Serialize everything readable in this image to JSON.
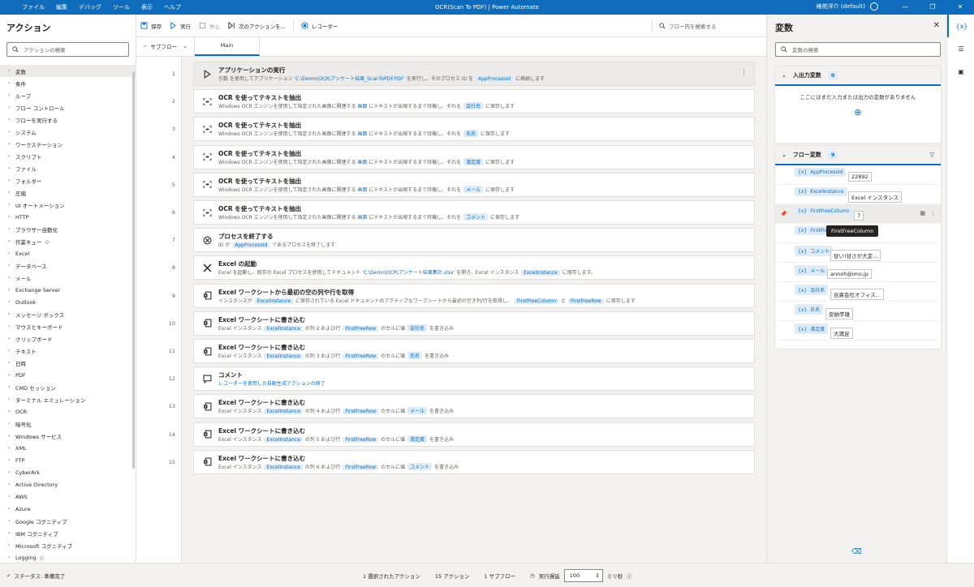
{
  "menu": [
    "ファイル",
    "編集",
    "デバッグ",
    "ツール",
    "表示",
    "ヘルプ"
  ],
  "window_title": "OCR(Scan To PDF) | Power Automate",
  "user": "椿苑洋介 (default)",
  "actions_panel": {
    "title": "アクション",
    "search_placeholder": "アクションの検索",
    "categories": [
      "変数",
      "条件",
      "ループ",
      "フロー コントロール",
      "フローを実行する",
      "システム",
      "ワークステーション",
      "スクリプト",
      "ファイル",
      "フォルダー",
      "圧縮",
      "UI オートメーション",
      "HTTP",
      "ブラウザー自動化",
      "作業キュー",
      "Excel",
      "データベース",
      "メール",
      "Exchange Server",
      "Outlook",
      "メッセージ ボックス",
      "マウスとキーボード",
      "クリップボード",
      "テキスト",
      "日時",
      "PDF",
      "CMD セッション",
      "ターミナル エミュレーション",
      "OCR",
      "暗号化",
      "Windows サービス",
      "XML",
      "FTP",
      "CyberArk",
      "Active Directory",
      "AWS",
      "Azure",
      "Google コグニティブ",
      "IBM コグニティブ",
      "Microsoft コグニティブ",
      "Logging"
    ]
  },
  "toolbar": {
    "save": "保存",
    "run": "実行",
    "stop": "停止",
    "next": "次のアクションを...",
    "recorder": "レコーダー",
    "search": "フロー内を検索する"
  },
  "tabs": {
    "subflow": "サブフロー",
    "main": "Main"
  },
  "steps": [
    {
      "n": "1",
      "icon": "play",
      "title": "アプリケーションの実行",
      "desc": [
        [
          "t",
          "引数 を使用してアプリケーション "
        ],
        [
          "l",
          "'C:\\Demo\\OCR\\アンケート結果_ScanToPDF.PDF'"
        ],
        [
          "t",
          " を実行し、そのプロセス ID を "
        ],
        [
          "v",
          "AppProcessId"
        ],
        [
          "t",
          " に格納します"
        ]
      ]
    },
    {
      "n": "2",
      "icon": "ocr",
      "title": "OCR を使ってテキストを抽出",
      "desc": [
        [
          "t",
          "Windows OCR エンジンを使用して指定された画像に関連する "
        ],
        [
          "l",
          "画面"
        ],
        [
          "t",
          " にテキストが出現するまで待機し、それを "
        ],
        [
          "v",
          "会社名"
        ],
        [
          "t",
          " に保存します"
        ]
      ]
    },
    {
      "n": "3",
      "icon": "ocr",
      "title": "OCR を使ってテキストを抽出",
      "desc": [
        [
          "t",
          "Windows OCR エンジンを使用して指定された画像に関連する "
        ],
        [
          "l",
          "画面"
        ],
        [
          "t",
          " にテキストが出現するまで待機し、それを "
        ],
        [
          "v",
          "氏名"
        ],
        [
          "t",
          " に保存します"
        ]
      ]
    },
    {
      "n": "4",
      "icon": "ocr",
      "title": "OCR を使ってテキストを抽出",
      "desc": [
        [
          "t",
          "Windows OCR エンジンを使用して指定された画像に関連する "
        ],
        [
          "l",
          "画面"
        ],
        [
          "t",
          " にテキストが出現するまで待機し、それを "
        ],
        [
          "v",
          "満足度"
        ],
        [
          "t",
          " に保存します"
        ]
      ]
    },
    {
      "n": "5",
      "icon": "ocr",
      "title": "OCR を使ってテキストを抽出",
      "desc": [
        [
          "t",
          "Windows OCR エンジンを使用して指定された画像に関連する "
        ],
        [
          "l",
          "画面"
        ],
        [
          "t",
          " にテキストが出現するまで待機し、それを "
        ],
        [
          "v",
          "メール"
        ],
        [
          "t",
          " に保存します"
        ]
      ]
    },
    {
      "n": "6",
      "icon": "ocr",
      "title": "OCR を使ってテキストを抽出",
      "desc": [
        [
          "t",
          "Windows OCR エンジンを使用して指定された画像に関連する "
        ],
        [
          "l",
          "画面"
        ],
        [
          "t",
          " にテキストが出現するまで待機し、それを "
        ],
        [
          "v",
          "コメント"
        ],
        [
          "t",
          " に保存します"
        ]
      ]
    },
    {
      "n": "7",
      "icon": "close",
      "title": "プロセスを終了する",
      "desc": [
        [
          "t",
          "ID が "
        ],
        [
          "v",
          "AppProcessId"
        ],
        [
          "t",
          " であるプロセスを終了します"
        ]
      ]
    },
    {
      "n": "8",
      "icon": "excel",
      "title": "Excel の起動",
      "desc": [
        [
          "t",
          "Excel を起動し、既存の Excel プロセスを使用してドキュメント "
        ],
        [
          "l",
          "'C:\\Demo\\OCR\\アンケート結果集計.xlsx'"
        ],
        [
          "t",
          " を開き、Excel インスタンス "
        ],
        [
          "v",
          "ExcelInstance"
        ],
        [
          "t",
          " に保存します。"
        ]
      ]
    },
    {
      "n": "9",
      "icon": "sheet",
      "title": "Excel ワークシートから最初の空の列や行を取得",
      "desc": [
        [
          "t",
          "インスタンスが "
        ],
        [
          "v",
          "ExcelInstance"
        ],
        [
          "t",
          " に保存されている Excel ドキュメントのアクティブなワークシートから最初の空き列/行を取得し、 "
        ],
        [
          "v",
          "FirstFreeColumn"
        ],
        [
          "t",
          " と "
        ],
        [
          "v",
          "FirstFreeRow"
        ],
        [
          "t",
          " に保存します"
        ]
      ]
    },
    {
      "n": "10",
      "icon": "sheet",
      "title": "Excel ワークシートに書き込む",
      "desc": [
        [
          "t",
          "Excel インスタンス "
        ],
        [
          "v",
          "ExcelInstance"
        ],
        [
          "t",
          " の列 2 および行 "
        ],
        [
          "v",
          "FirstFreeRow"
        ],
        [
          "t",
          " のセルに値 "
        ],
        [
          "v",
          "会社名"
        ],
        [
          "t",
          " を書き込み"
        ]
      ]
    },
    {
      "n": "11",
      "icon": "sheet",
      "title": "Excel ワークシートに書き込む",
      "desc": [
        [
          "t",
          "Excel インスタンス "
        ],
        [
          "v",
          "ExcelInstance"
        ],
        [
          "t",
          " の列 3 および行 "
        ],
        [
          "v",
          "FirstFreeRow"
        ],
        [
          "t",
          " のセルに値 "
        ],
        [
          "v",
          "氏名"
        ],
        [
          "t",
          " を書き込み"
        ]
      ]
    },
    {
      "n": "12",
      "icon": "comment",
      "title": "コメント",
      "desc": [
        [
          "c",
          "レコーダーを使用した自動生成アクションの終了"
        ]
      ]
    },
    {
      "n": "13",
      "icon": "sheet",
      "title": "Excel ワークシートに書き込む",
      "desc": [
        [
          "t",
          "Excel インスタンス "
        ],
        [
          "v",
          "ExcelInstance"
        ],
        [
          "t",
          " の列 4 および行 "
        ],
        [
          "v",
          "FirstFreeRow"
        ],
        [
          "t",
          " のセルに値 "
        ],
        [
          "v",
          "メール"
        ],
        [
          "t",
          " を書き込み"
        ]
      ]
    },
    {
      "n": "14",
      "icon": "sheet",
      "title": "Excel ワークシートに書き込む",
      "desc": [
        [
          "t",
          "Excel インスタンス "
        ],
        [
          "v",
          "ExcelInstance"
        ],
        [
          "t",
          " の列 5 および行 "
        ],
        [
          "v",
          "FirstFreeRow"
        ],
        [
          "t",
          " のセルに値 "
        ],
        [
          "v",
          "満足度"
        ],
        [
          "t",
          " を書き込み"
        ]
      ]
    },
    {
      "n": "15",
      "icon": "sheet",
      "title": "Excel ワークシートに書き込む",
      "desc": [
        [
          "t",
          "Excel インスタンス "
        ],
        [
          "v",
          "ExcelInstance"
        ],
        [
          "t",
          " の列 6 および行 "
        ],
        [
          "v",
          "FirstFreeRow"
        ],
        [
          "t",
          " のセルに値 "
        ],
        [
          "v",
          "コメント"
        ],
        [
          "t",
          " を書き込み"
        ]
      ]
    }
  ],
  "variables_panel": {
    "title": "変数",
    "search_placeholder": "変数の検索",
    "io_title": "入出力変数",
    "io_count": "0",
    "io_empty": "ここにはまだ入力または出力の変数がありません",
    "flow_title": "フロー変数",
    "flow_count": "9",
    "tooltip": "FirstFreeColumn",
    "vars": [
      {
        "name": "AppProcessId",
        "value": "22892"
      },
      {
        "name": "ExcelInstance",
        "value": "Excel インスタンス"
      },
      {
        "name": "FirstFreeColumn",
        "value": "7"
      },
      {
        "name": "FirstFreeRow",
        "value": ""
      },
      {
        "name": "コメント",
        "value": "甘い!甘さが大変..."
      },
      {
        "name": "メール",
        "value": "annoh@imo.jp"
      },
      {
        "name": "会社名",
        "value": "合資会社オフィス..."
      },
      {
        "name": "氏名",
        "value": "安納芋雄"
      },
      {
        "name": "満足度",
        "value": "大満足"
      }
    ]
  },
  "status": {
    "state": "ステータス: 準備完了",
    "selected": "1 選択されたアクション",
    "actions": "15 アクション",
    "subflows": "1 サブフロー",
    "delay_label": "実行遅延",
    "delay_value": "100",
    "unit": "ミリ秒"
  }
}
